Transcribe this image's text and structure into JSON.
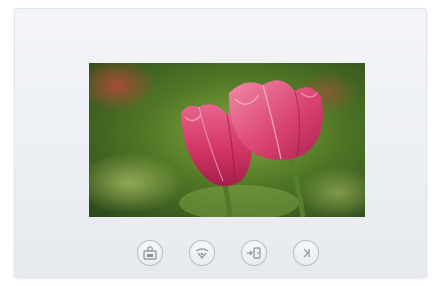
{
  "device": {
    "screen_image": "pink-tulips-photo",
    "buttons": [
      {
        "icon": "monitor-icon"
      },
      {
        "icon": "talk-icon"
      },
      {
        "icon": "unlock-icon"
      },
      {
        "icon": "menu-icon"
      }
    ]
  },
  "colors": {
    "bezel": "#eceff3",
    "button_outline": "#b7bcc6",
    "tulip": "#d23a6a"
  }
}
